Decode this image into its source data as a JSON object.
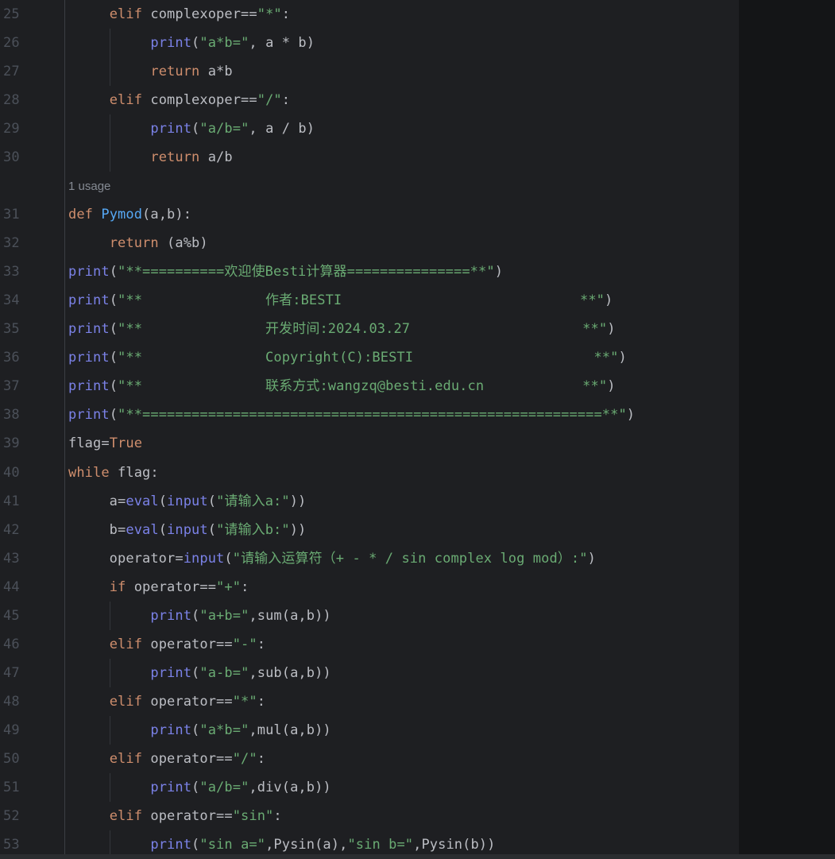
{
  "app": "code-editor-dark-theme",
  "ui": {
    "inlay_hint": "1 usage",
    "colors": {
      "editor_background": "#1e1f22",
      "right_empty_background": "#141517",
      "bottom_strip": "#2b2d30",
      "gutter_separator": "#3b3e43",
      "indent_guide": "#33363a",
      "line_number": "#4b5059",
      "keyword": "#cf8e6d",
      "string": "#6aab73",
      "builtin_call": "#7b82e8",
      "function_declaration": "#56a8f5",
      "default_text": "#bcbec4",
      "inlay_text": "#858a93"
    }
  },
  "editor": {
    "first_visible_line": 25,
    "last_visible_line": 53,
    "lines": [
      {
        "num": "25",
        "tokens": [
          [
            "d",
            "     "
          ],
          [
            "k",
            "elif"
          ],
          [
            "d",
            " complexoper=="
          ],
          [
            "s",
            "\"*\""
          ],
          [
            "d",
            ":"
          ]
        ]
      },
      {
        "num": "26",
        "guide": true,
        "tokens": [
          [
            "d",
            "          "
          ],
          [
            "b",
            "print"
          ],
          [
            "d",
            "("
          ],
          [
            "s",
            "\"a*b=\""
          ],
          [
            "d",
            ", a * b)"
          ]
        ]
      },
      {
        "num": "27",
        "guide": true,
        "tokens": [
          [
            "d",
            "          "
          ],
          [
            "k",
            "return"
          ],
          [
            "d",
            " a*b"
          ]
        ]
      },
      {
        "num": "28",
        "tokens": [
          [
            "d",
            "     "
          ],
          [
            "k",
            "elif"
          ],
          [
            "d",
            " complexoper=="
          ],
          [
            "s",
            "\"/\""
          ],
          [
            "d",
            ":"
          ]
        ]
      },
      {
        "num": "29",
        "guide": true,
        "tokens": [
          [
            "d",
            "          "
          ],
          [
            "b",
            "print"
          ],
          [
            "d",
            "("
          ],
          [
            "s",
            "\"a/b=\""
          ],
          [
            "d",
            ", a / b)"
          ]
        ]
      },
      {
        "num": "30",
        "guide": true,
        "tokens": [
          [
            "d",
            "          "
          ],
          [
            "k",
            "return"
          ],
          [
            "d",
            " a/b"
          ]
        ]
      },
      {
        "num": "",
        "inlay": true,
        "tokens": []
      },
      {
        "num": "31",
        "tokens": [
          [
            "k",
            "def"
          ],
          [
            "d",
            " "
          ],
          [
            "f",
            "Pymod"
          ],
          [
            "d",
            "(a,b):"
          ]
        ]
      },
      {
        "num": "32",
        "tokens": [
          [
            "d",
            "     "
          ],
          [
            "k",
            "return"
          ],
          [
            "d",
            " (a%b)"
          ]
        ]
      },
      {
        "num": "33",
        "tokens": [
          [
            "b",
            "print"
          ],
          [
            "d",
            "("
          ],
          [
            "s",
            "\"**==========欢迎使Besti计算器===============**\""
          ],
          [
            "d",
            ")"
          ]
        ]
      },
      {
        "num": "34",
        "tokens": [
          [
            "b",
            "print"
          ],
          [
            "d",
            "("
          ],
          [
            "s",
            "\"**               作者:BESTI                             **\""
          ],
          [
            "d",
            ")"
          ]
        ]
      },
      {
        "num": "35",
        "tokens": [
          [
            "b",
            "print"
          ],
          [
            "d",
            "("
          ],
          [
            "s",
            "\"**               开发时间:2024.03.27                     **\""
          ],
          [
            "d",
            ")"
          ]
        ]
      },
      {
        "num": "36",
        "tokens": [
          [
            "b",
            "print"
          ],
          [
            "d",
            "("
          ],
          [
            "s",
            "\"**               Copyright(C):BESTI                      **\""
          ],
          [
            "d",
            ")"
          ]
        ]
      },
      {
        "num": "37",
        "tokens": [
          [
            "b",
            "print"
          ],
          [
            "d",
            "("
          ],
          [
            "s",
            "\"**               联系方式:wangzq@besti.edu.cn            **\""
          ],
          [
            "d",
            ")"
          ]
        ]
      },
      {
        "num": "38",
        "tokens": [
          [
            "b",
            "print"
          ],
          [
            "d",
            "("
          ],
          [
            "s",
            "\"**========================================================**\""
          ],
          [
            "d",
            ")"
          ]
        ]
      },
      {
        "num": "39",
        "tokens": [
          [
            "d",
            "flag="
          ],
          [
            "k",
            "True"
          ]
        ]
      },
      {
        "num": "40",
        "tokens": [
          [
            "k",
            "while"
          ],
          [
            "d",
            " flag:"
          ]
        ]
      },
      {
        "num": "41",
        "tokens": [
          [
            "d",
            "     a="
          ],
          [
            "b",
            "eval"
          ],
          [
            "d",
            "("
          ],
          [
            "b",
            "input"
          ],
          [
            "d",
            "("
          ],
          [
            "s",
            "\"请输入a:\""
          ],
          [
            "d",
            "))"
          ]
        ]
      },
      {
        "num": "42",
        "tokens": [
          [
            "d",
            "     b="
          ],
          [
            "b",
            "eval"
          ],
          [
            "d",
            "("
          ],
          [
            "b",
            "input"
          ],
          [
            "d",
            "("
          ],
          [
            "s",
            "\"请输入b:\""
          ],
          [
            "d",
            "))"
          ]
        ]
      },
      {
        "num": "43",
        "tokens": [
          [
            "d",
            "     operator="
          ],
          [
            "b",
            "input"
          ],
          [
            "d",
            "("
          ],
          [
            "s",
            "\"请输入运算符（+ - * / sin complex log mod）:\""
          ],
          [
            "d",
            ")"
          ]
        ]
      },
      {
        "num": "44",
        "tokens": [
          [
            "d",
            "     "
          ],
          [
            "k",
            "if"
          ],
          [
            "d",
            " operator=="
          ],
          [
            "s",
            "\"+\""
          ],
          [
            "d",
            ":"
          ]
        ]
      },
      {
        "num": "45",
        "guide": true,
        "tokens": [
          [
            "d",
            "          "
          ],
          [
            "b",
            "print"
          ],
          [
            "d",
            "("
          ],
          [
            "s",
            "\"a+b=\""
          ],
          [
            "d",
            ",sum(a,b))"
          ]
        ]
      },
      {
        "num": "46",
        "tokens": [
          [
            "d",
            "     "
          ],
          [
            "k",
            "elif"
          ],
          [
            "d",
            " operator=="
          ],
          [
            "s",
            "\"-\""
          ],
          [
            "d",
            ":"
          ]
        ]
      },
      {
        "num": "47",
        "guide": true,
        "tokens": [
          [
            "d",
            "          "
          ],
          [
            "b",
            "print"
          ],
          [
            "d",
            "("
          ],
          [
            "s",
            "\"a-b=\""
          ],
          [
            "d",
            ",sub(a,b))"
          ]
        ]
      },
      {
        "num": "48",
        "tokens": [
          [
            "d",
            "     "
          ],
          [
            "k",
            "elif"
          ],
          [
            "d",
            " operator=="
          ],
          [
            "s",
            "\"*\""
          ],
          [
            "d",
            ":"
          ]
        ]
      },
      {
        "num": "49",
        "guide": true,
        "tokens": [
          [
            "d",
            "          "
          ],
          [
            "b",
            "print"
          ],
          [
            "d",
            "("
          ],
          [
            "s",
            "\"a*b=\""
          ],
          [
            "d",
            ",mul(a,b))"
          ]
        ]
      },
      {
        "num": "50",
        "tokens": [
          [
            "d",
            "     "
          ],
          [
            "k",
            "elif"
          ],
          [
            "d",
            " operator=="
          ],
          [
            "s",
            "\"/\""
          ],
          [
            "d",
            ":"
          ]
        ]
      },
      {
        "num": "51",
        "guide": true,
        "tokens": [
          [
            "d",
            "          "
          ],
          [
            "b",
            "print"
          ],
          [
            "d",
            "("
          ],
          [
            "s",
            "\"a/b=\""
          ],
          [
            "d",
            ",div(a,b))"
          ]
        ]
      },
      {
        "num": "52",
        "tokens": [
          [
            "d",
            "     "
          ],
          [
            "k",
            "elif"
          ],
          [
            "d",
            " operator=="
          ],
          [
            "s",
            "\"sin\""
          ],
          [
            "d",
            ":"
          ]
        ]
      },
      {
        "num": "53",
        "guide": true,
        "tokens": [
          [
            "d",
            "          "
          ],
          [
            "b",
            "print"
          ],
          [
            "d",
            "("
          ],
          [
            "s",
            "\"sin a=\""
          ],
          [
            "d",
            ",Pysin(a),"
          ],
          [
            "s",
            "\"sin b=\""
          ],
          [
            "d",
            ",Pysin(b))"
          ]
        ]
      }
    ]
  }
}
